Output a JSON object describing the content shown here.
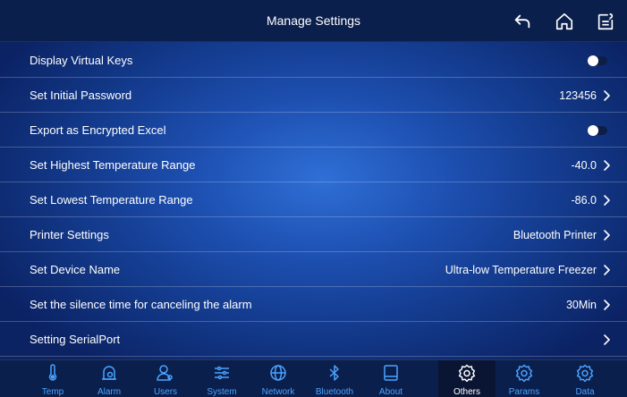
{
  "header": {
    "title": "Manage Settings",
    "back_icon": "back-arrow-icon",
    "home_icon": "home-icon",
    "notes_icon": "notes-icon"
  },
  "settings": [
    {
      "label": "Display Virtual Keys",
      "type": "toggle",
      "on": true
    },
    {
      "label": "Set Initial Password",
      "type": "value",
      "value": "123456"
    },
    {
      "label": "Export as Encrypted Excel",
      "type": "toggle",
      "on": true
    },
    {
      "label": "Set Highest Temperature Range",
      "type": "value",
      "value": "-40.0"
    },
    {
      "label": "Set Lowest Temperature Range",
      "type": "value",
      "value": "-86.0"
    },
    {
      "label": "Printer Settings",
      "type": "value",
      "value": "Bluetooth Printer"
    },
    {
      "label": "Set Device Name",
      "type": "value",
      "value": "Ultra-low Temperature Freezer"
    },
    {
      "label": "Set the silence time for canceling the alarm",
      "type": "value",
      "value": "30Min"
    },
    {
      "label": "Setting SerialPort",
      "type": "value",
      "value": ""
    }
  ],
  "tabs": [
    {
      "label": "Temp",
      "icon": "thermometer-icon",
      "active": false
    },
    {
      "label": "Alarm",
      "icon": "alarm-bell-icon",
      "active": false
    },
    {
      "label": "Users",
      "icon": "users-icon",
      "active": false
    },
    {
      "label": "System",
      "icon": "sliders-icon",
      "active": false
    },
    {
      "label": "Network",
      "icon": "globe-icon",
      "active": false
    },
    {
      "label": "Bluetooth",
      "icon": "bluetooth-icon",
      "active": false
    },
    {
      "label": "About",
      "icon": "tablet-icon",
      "active": false
    },
    {
      "label": "Others",
      "icon": "gear-icon",
      "active": true
    },
    {
      "label": "Params",
      "icon": "gear-icon",
      "active": false
    },
    {
      "label": "Data",
      "icon": "gear-icon",
      "active": false
    }
  ],
  "colors": {
    "header_bg": "#0b1f4d",
    "tab_label": "#4aa3ff",
    "active_tab_bg": "#0a1533"
  }
}
